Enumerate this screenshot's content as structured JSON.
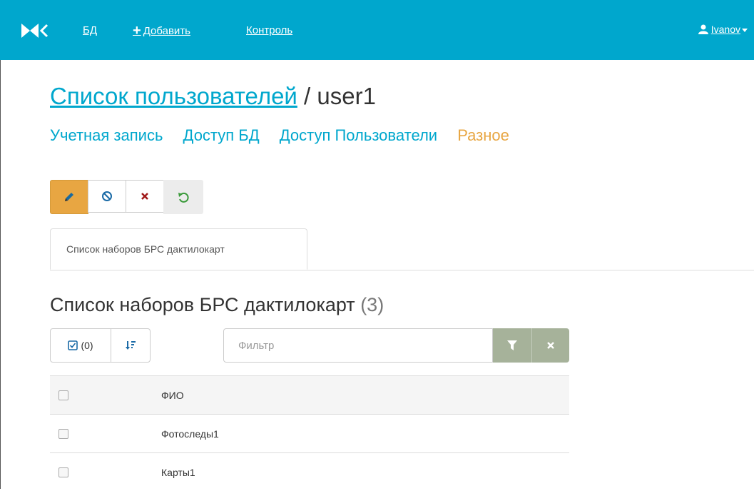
{
  "navbar": {
    "logo_icon": "xk-logo-icon",
    "links": [
      {
        "label": "БД"
      },
      {
        "label": "Добавить",
        "icon": "plus-icon"
      },
      {
        "label": "Контроль"
      }
    ],
    "user": {
      "label": "Ivanov",
      "icon": "user-icon"
    },
    "bg_color": "#00a7cd"
  },
  "title": {
    "link": "Список пользователей",
    "separator": " / ",
    "current": "user1"
  },
  "subnav": [
    {
      "label": "Учетная запись",
      "active": false
    },
    {
      "label": "Доступ БД",
      "active": false
    },
    {
      "label": "Доступ Пользователи",
      "active": false
    },
    {
      "label": "Разное",
      "active": true
    }
  ],
  "toolbar": {
    "buttons": [
      {
        "icon": "pencil-icon",
        "color": "#e8a642"
      },
      {
        "icon": "ban-icon"
      },
      {
        "icon": "close-icon"
      },
      {
        "icon": "restore-icon"
      }
    ]
  },
  "tabs": [
    {
      "label": "Список наборов БРС дактилокарт"
    }
  ],
  "section": {
    "title": "Список наборов БРС дактилокарт",
    "count": "(3)"
  },
  "controls": {
    "select_label": "(0)",
    "filter_placeholder": "Фильтр"
  },
  "table": {
    "header": "ФИО",
    "rows": [
      "Фотоследы1",
      "Карты1"
    ]
  }
}
